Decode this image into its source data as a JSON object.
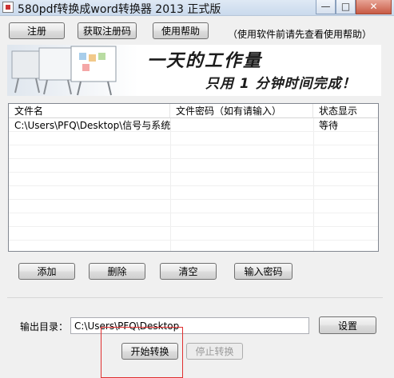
{
  "window": {
    "title": "580pdf转换成word转换器 2013 正式版",
    "min_glyph": "—",
    "max_glyph": "□",
    "close_glyph": "✕"
  },
  "toolbar": {
    "register": "注册",
    "get_code": "获取注册码",
    "help": "使用帮助",
    "hint": "（使用软件前请先查看使用帮助）"
  },
  "banner": {
    "line1": "一天的工作量",
    "line2": "只用 1 分钟时间完成！"
  },
  "table": {
    "columns": [
      "文件名",
      "文件密码（如有请输入）",
      "状态显示"
    ],
    "rows": [
      {
        "file": "C:\\Users\\PFQ\\Desktop\\信号与系统...",
        "password": "",
        "status": "等待"
      }
    ]
  },
  "actions": {
    "add": "添加",
    "delete": "删除",
    "clear": "清空",
    "password": "输入密码"
  },
  "output": {
    "label": "输出目录：",
    "value": "C:\\Users\\PFQ\\Desktop",
    "settings": "设置",
    "start": "开始转换",
    "stop": "停止转换"
  }
}
